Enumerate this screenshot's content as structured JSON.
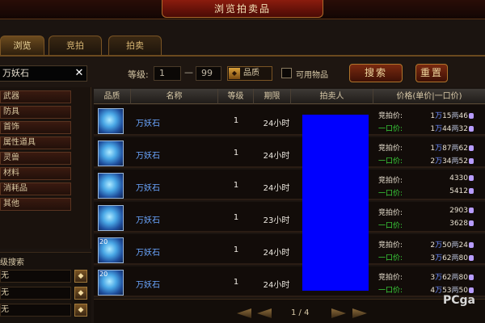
{
  "window": {
    "title": "浏览拍卖品"
  },
  "tabs": [
    {
      "label": "浏览"
    },
    {
      "label": "竞拍"
    },
    {
      "label": "拍卖"
    }
  ],
  "search": {
    "query": "万妖石",
    "level_label": "等级:",
    "level_min": "1",
    "level_max": "99",
    "level_dash": "—",
    "quality_label": "品质",
    "usable_label": "可用物品",
    "search_button": "搜索",
    "reset_button": "重置"
  },
  "categories": [
    "武器",
    "防具",
    "首饰",
    "属性道具",
    "灵兽",
    "材料",
    "消耗品",
    "其他"
  ],
  "advanced": {
    "title": "级搜索",
    "rows": [
      "无",
      "无",
      "无"
    ]
  },
  "table": {
    "headers": {
      "quality": "品质",
      "name": "名称",
      "level": "等级",
      "duration": "期限",
      "seller": "拍卖人",
      "price": "价格(单价|一口价)"
    },
    "bid_label": "竞拍价:",
    "buyout_label": "一口价:",
    "rows": [
      {
        "name": "万妖石",
        "level": "1",
        "duration": "24小时",
        "bid": [
          "1",
          "15",
          "46"
        ],
        "buyout": [
          "1",
          "44",
          "32"
        ]
      },
      {
        "name": "万妖石",
        "level": "1",
        "duration": "24小时",
        "bid": [
          "1",
          "87",
          "62"
        ],
        "buyout": [
          "2",
          "34",
          "52"
        ]
      },
      {
        "name": "万妖石",
        "level": "1",
        "duration": "24小时",
        "bid": [
          "",
          "",
          "4330"
        ],
        "buyout": [
          "",
          "",
          "5412"
        ]
      },
      {
        "name": "万妖石",
        "level": "1",
        "duration": "23小时",
        "bid": [
          "",
          "",
          "2903"
        ],
        "buyout": [
          "",
          "",
          "3628"
        ]
      },
      {
        "name": "万妖石",
        "level": "1",
        "duration": "24小时",
        "bid": [
          "2",
          "50",
          "24"
        ],
        "buyout": [
          "3",
          "62",
          "80"
        ]
      },
      {
        "name": "万妖石",
        "level": "1",
        "duration": "24小时",
        "bid": [
          "3",
          "62",
          "80"
        ],
        "buyout": [
          "4",
          "53",
          "50"
        ]
      }
    ],
    "stack_badges": [
      "",
      "",
      "",
      "",
      "20",
      "20"
    ]
  },
  "pager": {
    "text": "1 / 4"
  },
  "watermark": {
    "text": "PCga"
  },
  "colors": {
    "bid": "#e8e0d0",
    "buyout": "#3ad33a",
    "seller_block": "#0000ff",
    "item_name": "#6aa6ff"
  }
}
